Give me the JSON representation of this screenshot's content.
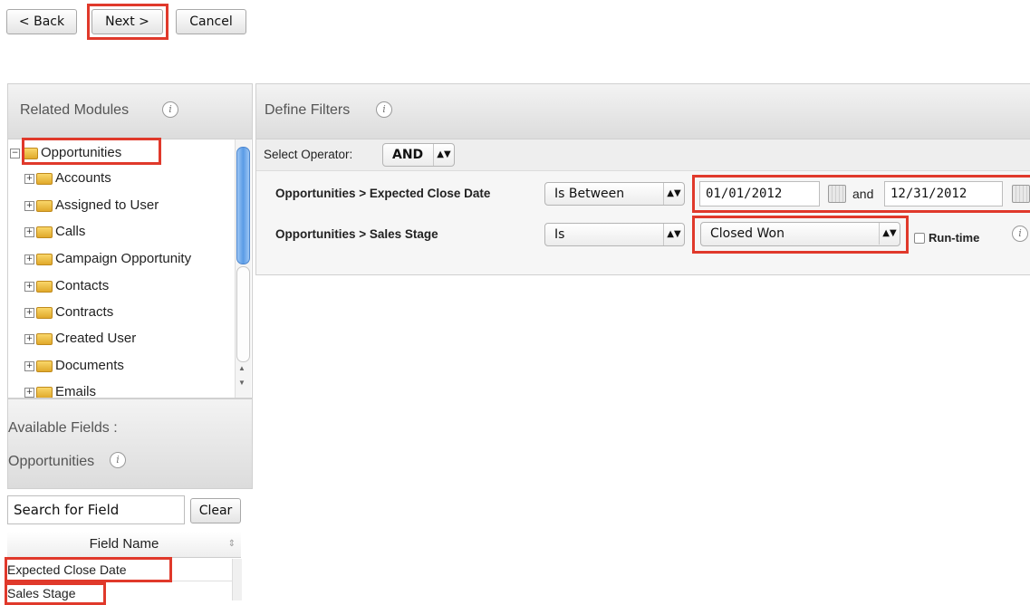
{
  "toolbar": {
    "back": "< Back",
    "next": "Next >",
    "cancel": "Cancel"
  },
  "related_modules": {
    "title": "Related Modules",
    "info_icon": "i",
    "root": "Opportunities",
    "items": [
      "Accounts",
      "Assigned to User",
      "Calls",
      "Campaign Opportunity",
      "Contacts",
      "Contracts",
      "Created User",
      "Documents",
      "Emails"
    ]
  },
  "available_fields": {
    "title_line1": "Available Fields :",
    "title_line2": "Opportunities",
    "search_placeholder": "Search for Field",
    "clear": "Clear",
    "column_header": "Field Name",
    "fields": [
      "Expected Close Date",
      "Sales Stage"
    ]
  },
  "define_filters": {
    "title": "Define Filters",
    "operator_label": "Select Operator:",
    "operator_value": "AND",
    "filters": [
      {
        "field": "Opportunities > Expected Close Date",
        "operator": "Is Between",
        "value_from": "01/01/2012",
        "and_label": "and",
        "value_to": "12/31/2012"
      },
      {
        "field": "Opportunities > Sales Stage",
        "operator": "Is",
        "value": "Closed Won",
        "runtime_label": "Run-time"
      }
    ]
  },
  "colors": {
    "highlight": "#e0392b",
    "folder": "#f0c040"
  }
}
